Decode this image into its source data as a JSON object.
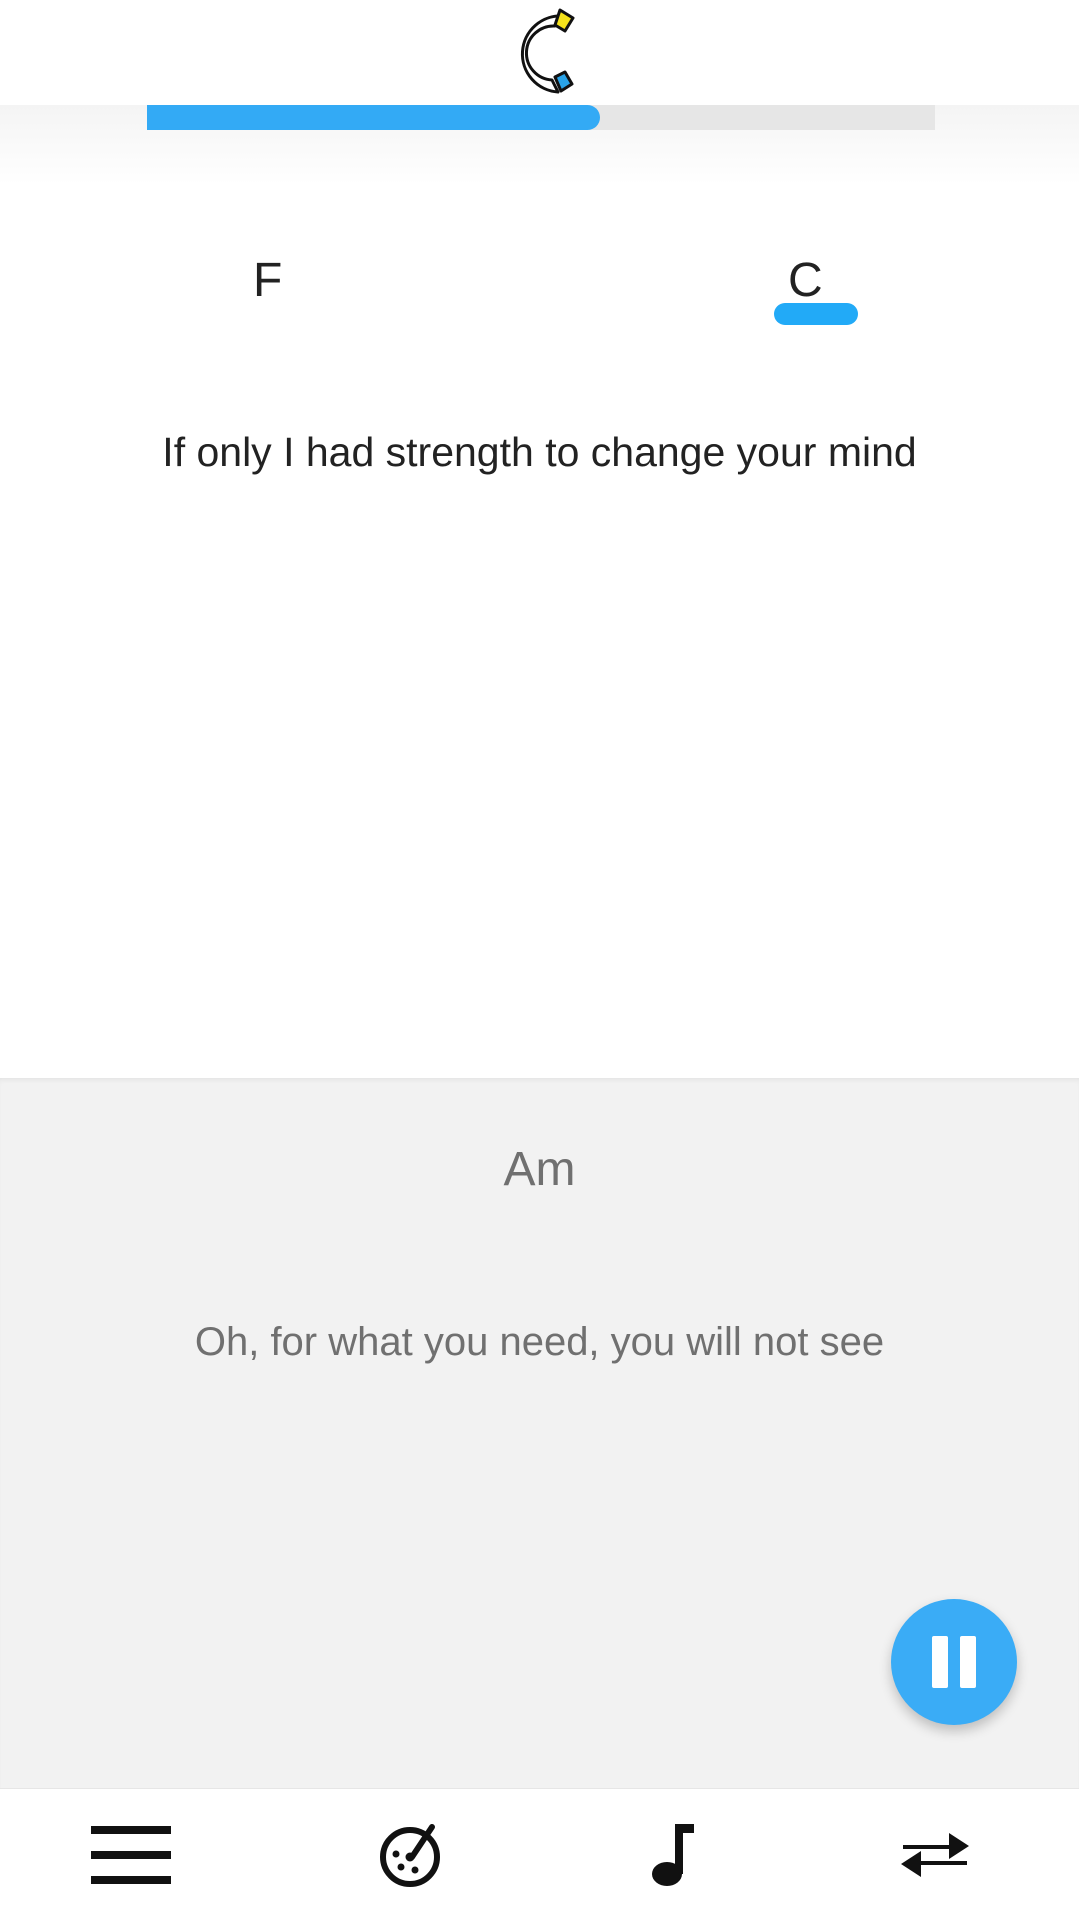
{
  "progress": {
    "fraction": 0.575
  },
  "current": {
    "chords": [
      "F",
      "C"
    ],
    "active_chord_index": 1,
    "lyric": "If only I had strength to change your mind"
  },
  "next": {
    "chord": "Am",
    "lyric": "Oh, for what you need, you will not see"
  },
  "playback": {
    "state": "playing",
    "button_icon": "pause-icon"
  },
  "bottom_nav": [
    {
      "icon": "menu-icon"
    },
    {
      "icon": "metronome-icon"
    },
    {
      "icon": "music-note-icon"
    },
    {
      "icon": "swap-arrows-icon"
    }
  ],
  "colors": {
    "accent": "#33aaf5",
    "logo_yellow": "#f5e21b",
    "logo_blue": "#29a3e8",
    "next_panel_bg": "#f2f2f2",
    "muted_text": "#707070"
  }
}
